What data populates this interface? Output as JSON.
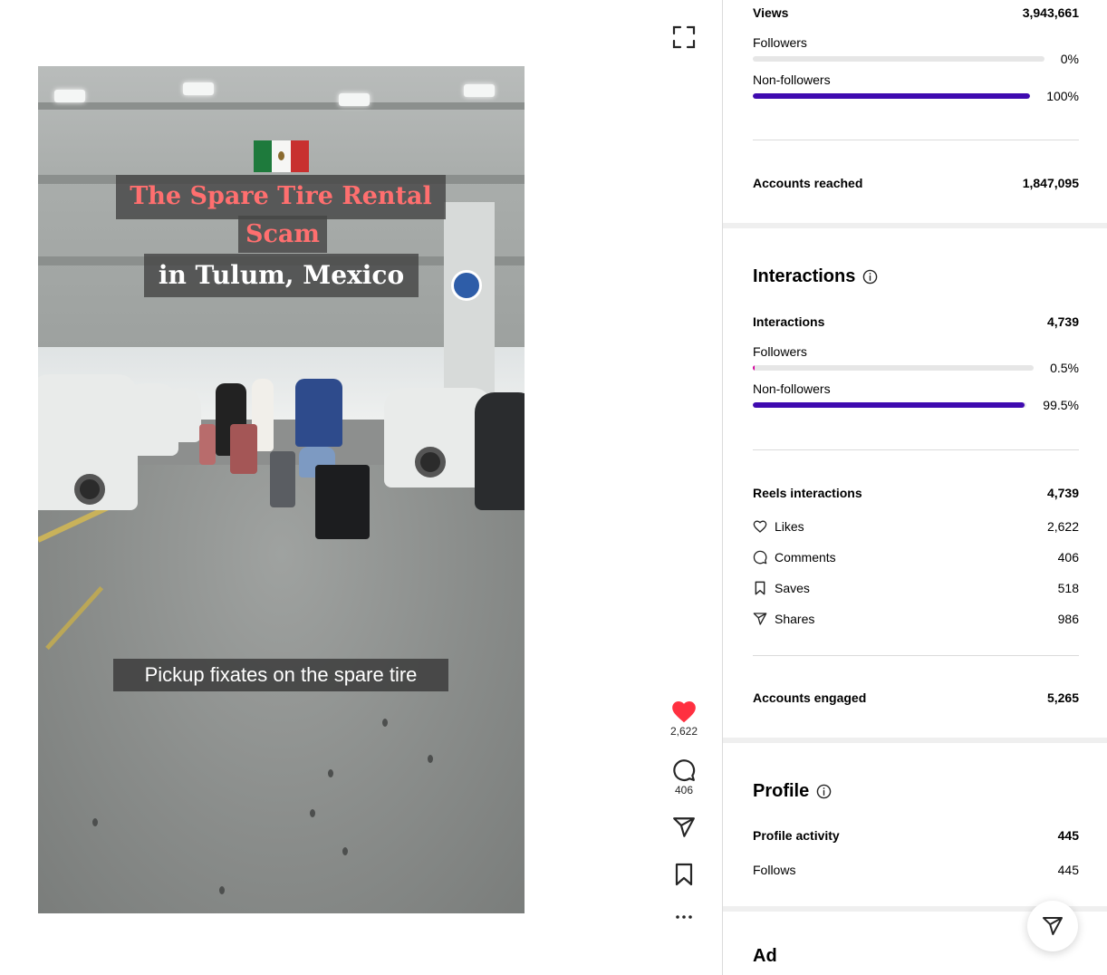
{
  "video": {
    "title_line1": "The Spare Tire Rental",
    "title_line2": "Scam",
    "title_line3": "in Tulum, Mexico",
    "caption": "Pickup fixates on the spare tire"
  },
  "actions": {
    "likes_count": "2,622",
    "comments_count": "406"
  },
  "views": {
    "label": "Views",
    "value": "3,943,661",
    "followers_label": "Followers",
    "followers_pct": "0%",
    "followers_fraction": 0,
    "nonfollowers_label": "Non-followers",
    "nonfollowers_pct": "100%",
    "nonfollowers_fraction": 1.0,
    "accounts_reached_label": "Accounts reached",
    "accounts_reached_value": "1,847,095"
  },
  "interactions": {
    "title": "Interactions",
    "total_label": "Interactions",
    "total_value": "4,739",
    "followers_label": "Followers",
    "followers_pct": "0.5%",
    "followers_fraction": 0.005,
    "nonfollowers_label": "Non-followers",
    "nonfollowers_pct": "99.5%",
    "nonfollowers_fraction": 0.995,
    "reels_label": "Reels interactions",
    "reels_value": "4,739",
    "likes_label": "Likes",
    "likes_value": "2,622",
    "comments_label": "Comments",
    "comments_value": "406",
    "saves_label": "Saves",
    "saves_value": "518",
    "shares_label": "Shares",
    "shares_value": "986",
    "accounts_engaged_label": "Accounts engaged",
    "accounts_engaged_value": "5,265"
  },
  "profile": {
    "title": "Profile",
    "activity_label": "Profile activity",
    "activity_value": "445",
    "follows_label": "Follows",
    "follows_value": "445"
  },
  "ad": {
    "title": "Ad"
  },
  "colors": {
    "bar_fill": "#3f0ab0",
    "bar_followers": "#d3009c",
    "like_red": "#ff3040",
    "track": "#e6e6e6"
  }
}
